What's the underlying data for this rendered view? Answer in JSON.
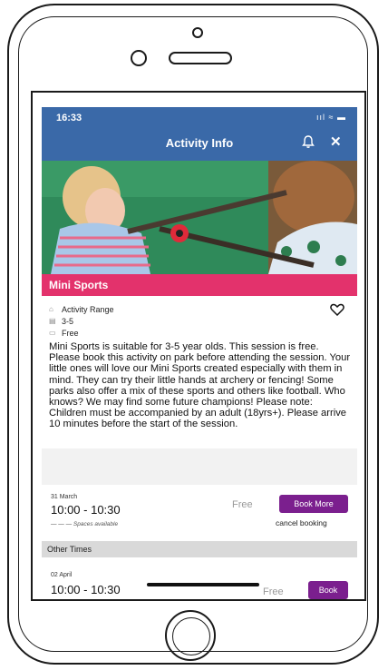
{
  "status": {
    "time": "16:33",
    "icons": "ııl ≈ ▬"
  },
  "header": {
    "title": "Activity Info"
  },
  "activity": {
    "name": "Mini Sports",
    "category": "Activity Range",
    "ages": "3-5",
    "price": "Free",
    "description": "Mini Sports is suitable for 3-5 year olds. This session is free. Please book this activity on park before attending the session. Your little ones will love our Mini Sports created especially with them in mind. They can try their little hands at archery or fencing! Some parks also offer a mix of these sports and others like football. Who knows? We may find some future champions! Please note: Children must be accompanied by an adult (18yrs+). Please arrive 10 minutes before the start of the session."
  },
  "booking": {
    "date": "31 March",
    "time": "10:00 - 10:30",
    "spaces": "— — —  Spaces available",
    "price": "Free",
    "book_label": "Book More",
    "cancel_label": "cancel booking"
  },
  "other_times": {
    "label": "Other Times",
    "slot": {
      "date": "02 April",
      "time": "10:00 - 10:30",
      "price": "Free",
      "book_label": "Book"
    }
  },
  "colors": {
    "header": "#3a69a8",
    "banner": "#e3326c",
    "button": "#7b1f8e"
  }
}
